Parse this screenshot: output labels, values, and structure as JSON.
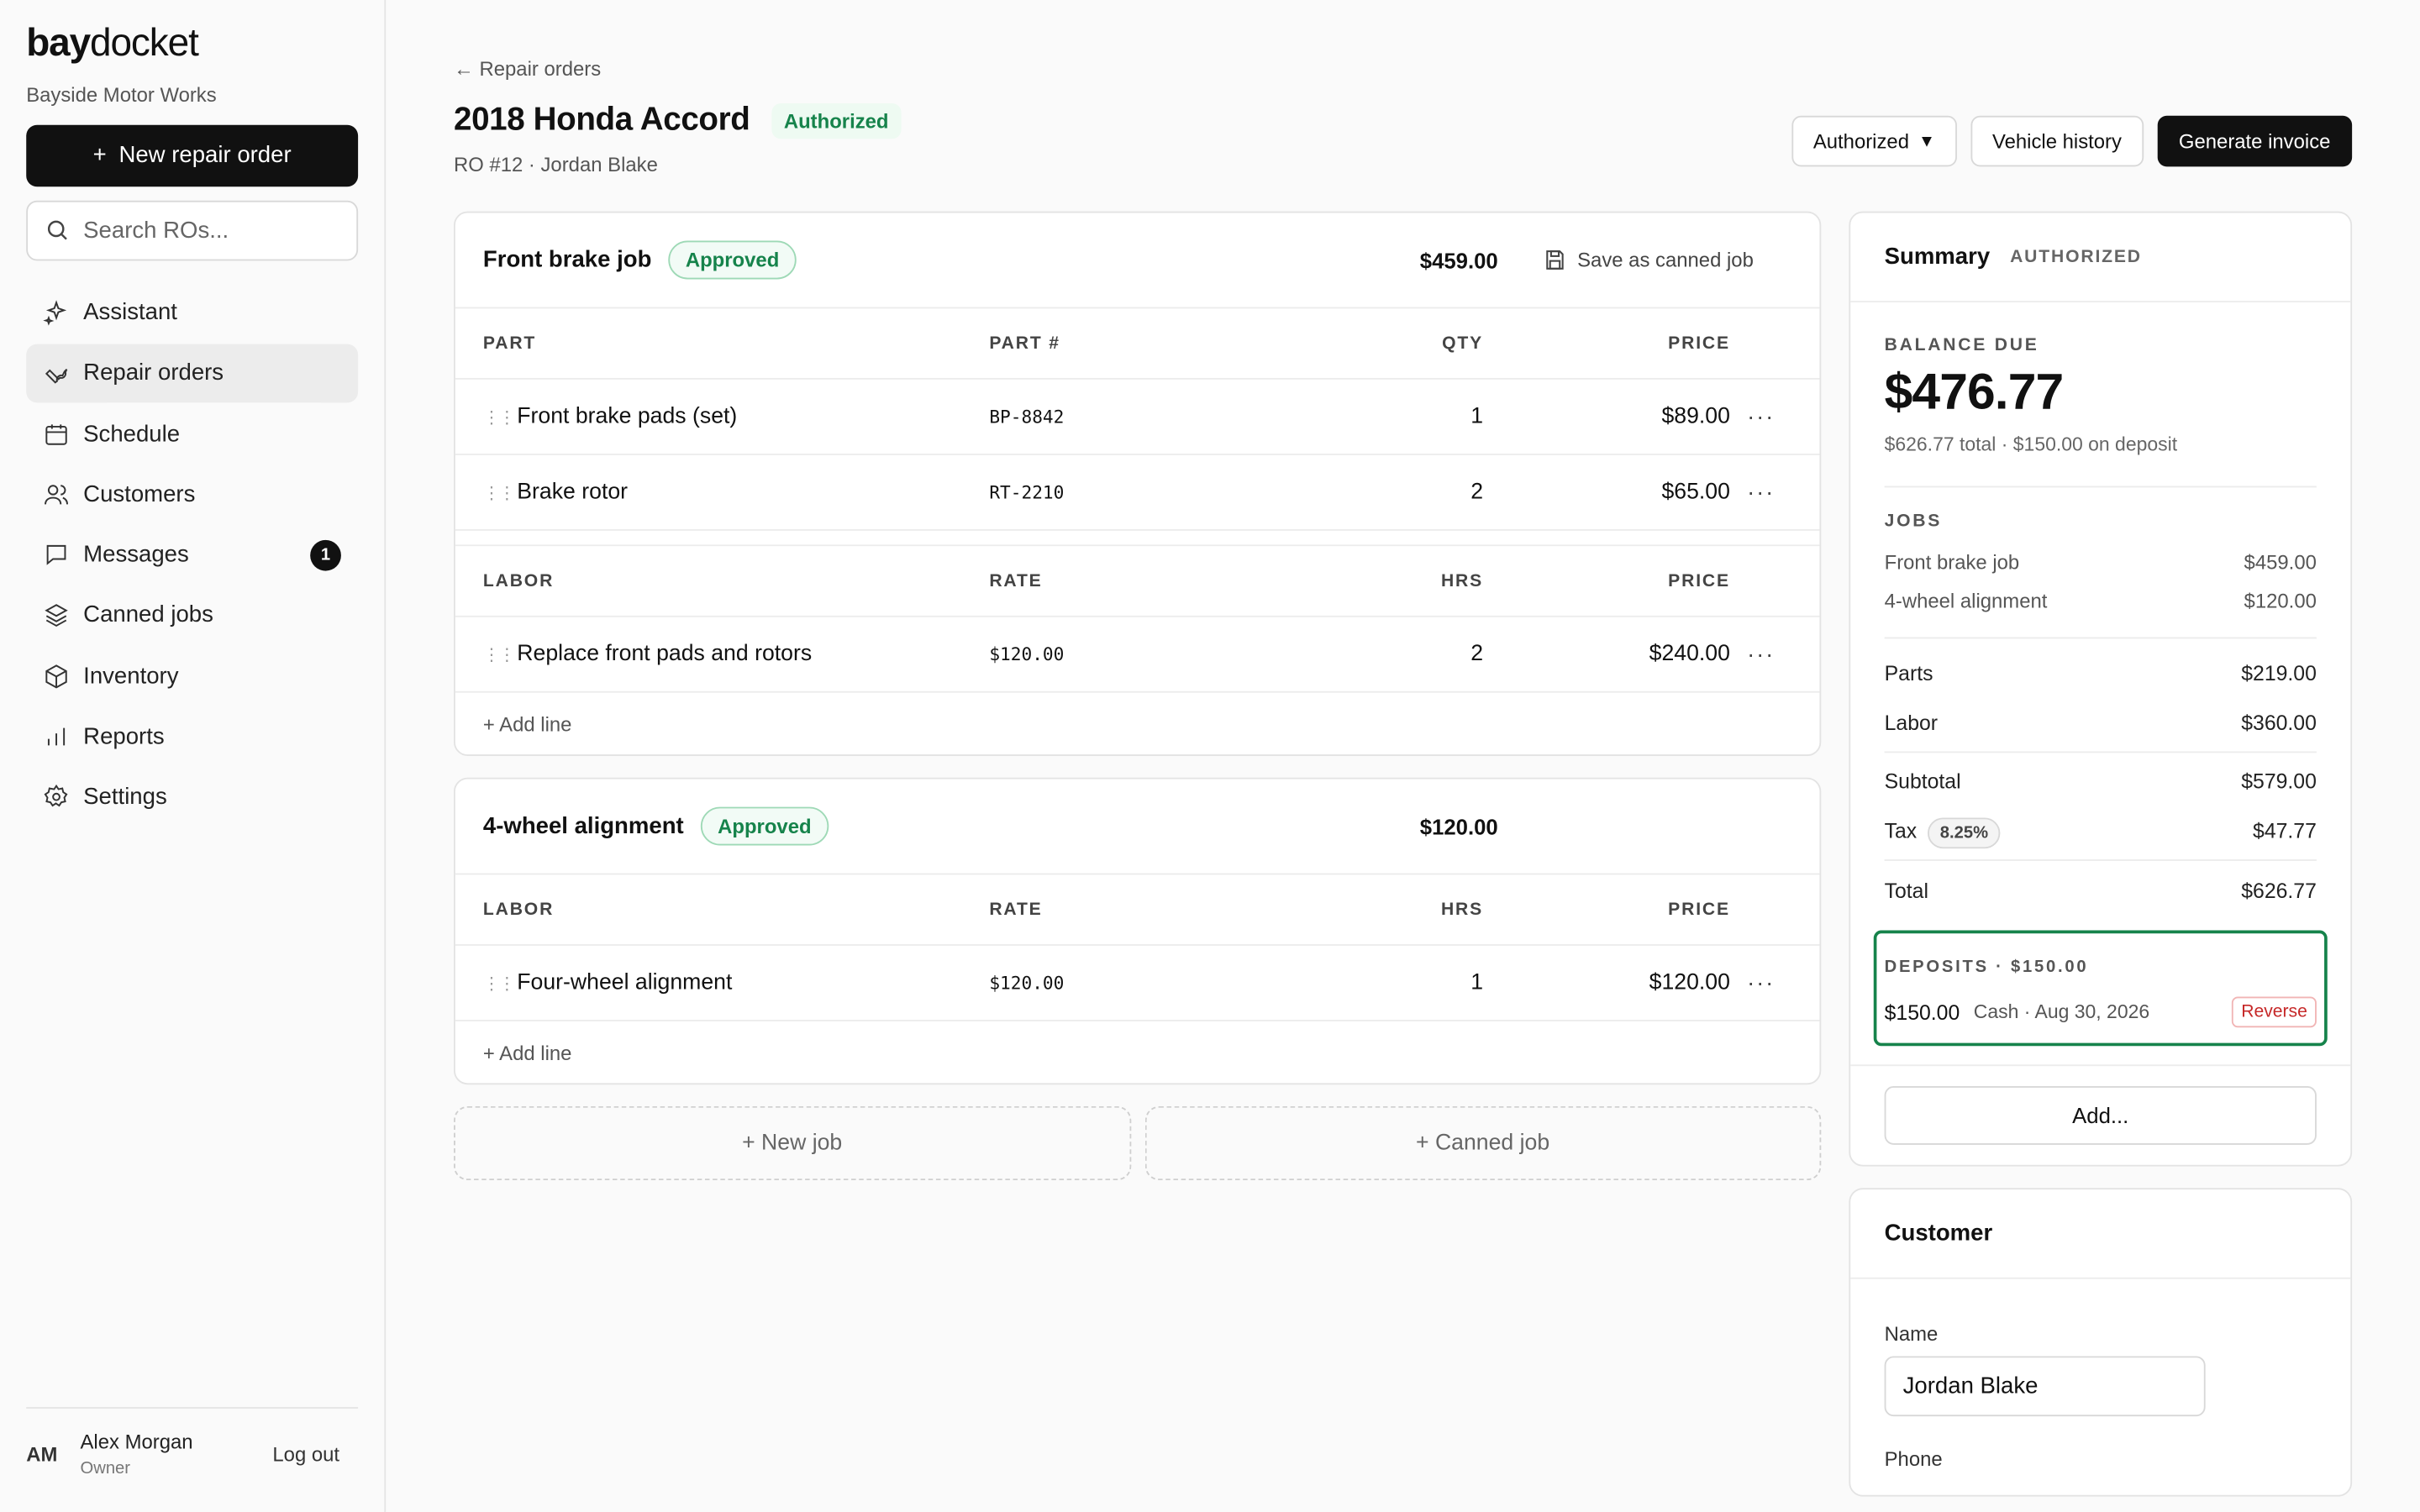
{
  "sidebar": {
    "brand_bold": "bay",
    "brand_rest": "docket",
    "shop_name": "Bayside Motor Works",
    "new_ro_label": "New repair order",
    "search_placeholder": "Search ROs...",
    "items": [
      {
        "label": "Assistant",
        "icon": "sparkle-icon"
      },
      {
        "label": "Repair orders",
        "icon": "wrench-icon",
        "active": true
      },
      {
        "label": "Schedule",
        "icon": "calendar-icon"
      },
      {
        "label": "Customers",
        "icon": "users-icon"
      },
      {
        "label": "Messages",
        "icon": "chat-icon",
        "badge": "1"
      },
      {
        "label": "Canned jobs",
        "icon": "layers-icon"
      },
      {
        "label": "Inventory",
        "icon": "box-icon"
      },
      {
        "label": "Reports",
        "icon": "bar-chart-icon"
      },
      {
        "label": "Settings",
        "icon": "gear-icon"
      }
    ],
    "user": {
      "initials": "AM",
      "name": "Alex Morgan",
      "role": "Owner",
      "logout": "Log out"
    }
  },
  "header": {
    "back_label": "← Repair orders",
    "title": "2018 Honda Accord",
    "status": "Authorized",
    "subtitle": "RO #12 · Jordan Blake",
    "status_select": "Authorized",
    "vehicle_history": "Vehicle history",
    "generate_invoice": "Generate invoice"
  },
  "jobs": [
    {
      "name": "Front brake job",
      "status": "Approved",
      "total": "$459.00",
      "save_canned": "Save as canned job",
      "parts_headers": [
        "PART",
        "PART #",
        "QTY",
        "PRICE"
      ],
      "parts": [
        {
          "desc": "Front brake pads (set)",
          "num": "BP-8842",
          "qty": "1",
          "price": "$89.00"
        },
        {
          "desc": "Brake rotor",
          "num": "RT-2210",
          "qty": "2",
          "price": "$65.00"
        }
      ],
      "labor_headers": [
        "LABOR",
        "RATE",
        "HRS",
        "PRICE"
      ],
      "labor": [
        {
          "desc": "Replace front pads and rotors",
          "rate": "$120.00",
          "hrs": "2",
          "price": "$240.00"
        }
      ],
      "add_line": "+ Add line"
    },
    {
      "name": "4-wheel alignment",
      "status": "Approved",
      "total": "$120.00",
      "labor_headers": [
        "LABOR",
        "RATE",
        "HRS",
        "PRICE"
      ],
      "labor": [
        {
          "desc": "Four-wheel alignment",
          "rate": "$120.00",
          "hrs": "1",
          "price": "$120.00"
        }
      ],
      "add_line": "+ Add line"
    }
  ],
  "new_job": "+ New job",
  "canned_job": "+ Canned job",
  "summary": {
    "title": "Summary",
    "status": "AUTHORIZED",
    "balance_label": "BALANCE DUE",
    "balance": "$476.77",
    "balance_note": "$626.77 total · $150.00 on deposit",
    "jobs_label": "JOBS",
    "jobs": [
      {
        "name": "Front brake job",
        "amount": "$459.00"
      },
      {
        "name": "4-wheel alignment",
        "amount": "$120.00"
      }
    ],
    "parts_label": "Parts",
    "parts": "$219.00",
    "labor_label": "Labor",
    "labor": "$360.00",
    "subtotal_label": "Subtotal",
    "subtotal": "$579.00",
    "tax_label": "Tax",
    "tax_rate": "8.25%",
    "tax": "$47.77",
    "total_label": "Total",
    "total": "$626.77",
    "deposits_label": "DEPOSITS · $150.00",
    "deposit": {
      "amount": "$150.00",
      "meta": "Cash · Aug 30, 2026",
      "reverse": "Reverse"
    },
    "add_label": "Add..."
  },
  "customer": {
    "title": "Customer",
    "name_label": "Name",
    "name_value": "Jordan Blake",
    "phone_label": "Phone"
  }
}
